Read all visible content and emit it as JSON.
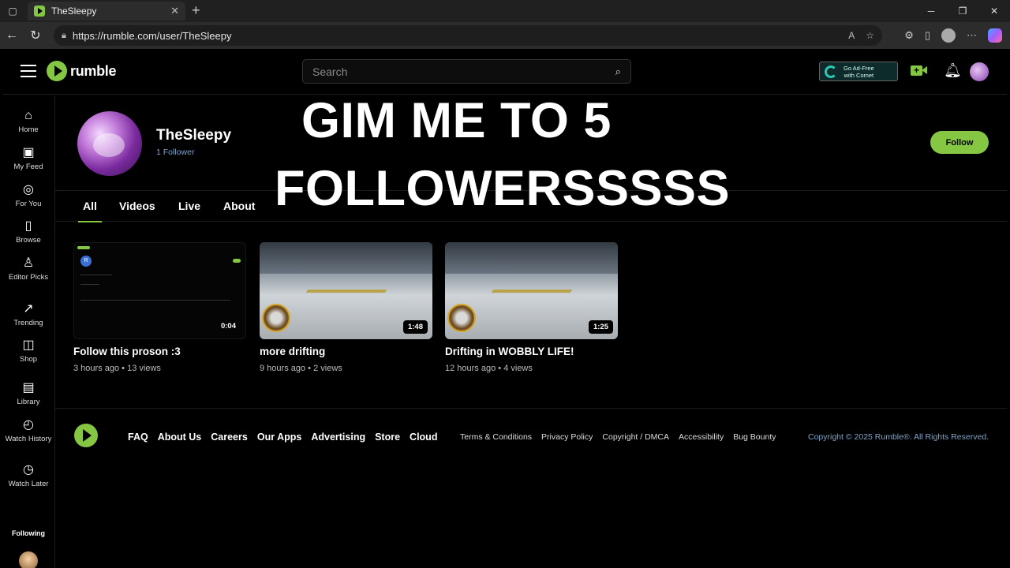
{
  "browser": {
    "tab_title": "TheSleepy",
    "url": "https://rumble.com/user/TheSleepy"
  },
  "header": {
    "logo_text": "rumble",
    "search_placeholder": "Search",
    "adfree_line1": "Go Ad-Free",
    "adfree_line2": "with Comet"
  },
  "sidebar": {
    "items": [
      {
        "label": "Home",
        "icon": "home-icon"
      },
      {
        "label": "My Feed",
        "icon": "feed-icon"
      },
      {
        "label": "For You",
        "icon": "target-icon"
      },
      {
        "label": "Browse",
        "icon": "browse-icon"
      },
      {
        "label": "Editor Picks",
        "icon": "award-icon"
      },
      {
        "label": "Trending",
        "icon": "trending-icon"
      },
      {
        "label": "Shop",
        "icon": "bag-icon"
      },
      {
        "label": "Library",
        "icon": "library-icon"
      },
      {
        "label": "Watch History",
        "icon": "history-icon"
      },
      {
        "label": "Watch Later",
        "icon": "clock-icon"
      }
    ],
    "following_label": "Following"
  },
  "profile": {
    "name": "TheSleepy",
    "followers": "1 Follower",
    "follow_label": "Follow"
  },
  "overlay": {
    "line1": "GIM ME TO 5",
    "line2": "FOLLOWERSSSSS"
  },
  "tabs": [
    "All",
    "Videos",
    "Live",
    "About"
  ],
  "videos": [
    {
      "title": "Follow this proson :3",
      "age": "3 hours ago",
      "views": "13",
      "views_label": "views",
      "duration": "0:04"
    },
    {
      "title": "more drifting",
      "age": "9 hours ago",
      "views": "2",
      "views_label": "views",
      "duration": "1:48"
    },
    {
      "title": "Drifting in WOBBLY LIFE!",
      "age": "12 hours ago",
      "views": "4",
      "views_label": "views",
      "duration": "1:25"
    }
  ],
  "footer": {
    "links": [
      "FAQ",
      "About Us",
      "Careers",
      "Our Apps",
      "Advertising",
      "Store",
      "Cloud"
    ],
    "legal": [
      "Terms & Conditions",
      "Privacy Policy",
      "Copyright / DMCA",
      "Accessibility",
      "Bug Bounty"
    ],
    "copyright": "Copyright © 2025 Rumble®. All Rights Reserved."
  },
  "colors": {
    "brand": "#85c742",
    "link_blue": "#7ea4c8"
  }
}
